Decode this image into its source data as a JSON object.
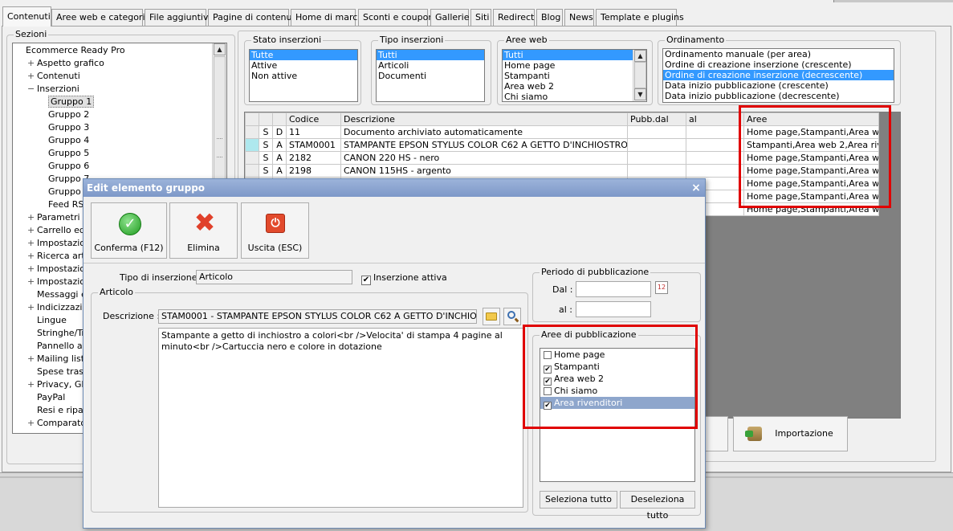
{
  "tabs": [
    "Contenuti",
    "Aree web e categorie",
    "File aggiuntivi",
    "Pagine di contenuti",
    "Home di marca",
    "Sconti e coupon",
    "Gallerie",
    "Siti",
    "Redirect",
    "Blog",
    "News",
    "Template e plugins"
  ],
  "sections": {
    "legend": "Sezioni",
    "tree": [
      {
        "label": "Ecommerce Ready Pro",
        "level": 0,
        "exp": ""
      },
      {
        "label": "Aspetto grafico",
        "level": 1,
        "exp": "+"
      },
      {
        "label": "Contenuti",
        "level": 1,
        "exp": "+"
      },
      {
        "label": "Inserzioni",
        "level": 1,
        "exp": "-"
      },
      {
        "label": "Gruppo 1",
        "level": 2,
        "exp": "",
        "selected": true
      },
      {
        "label": "Gruppo 2",
        "level": 2,
        "exp": ""
      },
      {
        "label": "Gruppo 3",
        "level": 2,
        "exp": ""
      },
      {
        "label": "Gruppo 4",
        "level": 2,
        "exp": ""
      },
      {
        "label": "Gruppo 5",
        "level": 2,
        "exp": ""
      },
      {
        "label": "Gruppo 6",
        "level": 2,
        "exp": ""
      },
      {
        "label": "Gruppo 7",
        "level": 2,
        "exp": ""
      },
      {
        "label": "Gruppo 8",
        "level": 2,
        "exp": ""
      },
      {
        "label": "Feed RSS",
        "level": 2,
        "exp": ""
      },
      {
        "label": "Parametri u",
        "level": 1,
        "exp": "+"
      },
      {
        "label": "Carrello ed",
        "level": 1,
        "exp": "+"
      },
      {
        "label": "Impostazio",
        "level": 1,
        "exp": "+"
      },
      {
        "label": "Ricerca arti",
        "level": 1,
        "exp": "+"
      },
      {
        "label": "Impostazio",
        "level": 1,
        "exp": "+"
      },
      {
        "label": "Impostazio",
        "level": 1,
        "exp": "+"
      },
      {
        "label": "Messaggi e",
        "level": 1,
        "exp": ""
      },
      {
        "label": "Indicizzazio",
        "level": 1,
        "exp": "+"
      },
      {
        "label": "Lingue",
        "level": 1,
        "exp": ""
      },
      {
        "label": "Stringhe/Tr",
        "level": 1,
        "exp": ""
      },
      {
        "label": "Pannello am",
        "level": 1,
        "exp": ""
      },
      {
        "label": "Mailing list e",
        "level": 1,
        "exp": "+"
      },
      {
        "label": "Spese trasp",
        "level": 1,
        "exp": ""
      },
      {
        "label": "Privacy, GD",
        "level": 1,
        "exp": "+"
      },
      {
        "label": "PayPal",
        "level": 1,
        "exp": ""
      },
      {
        "label": "Resi e ripar",
        "level": 1,
        "exp": ""
      },
      {
        "label": "Comparator",
        "level": 1,
        "exp": "+"
      }
    ]
  },
  "filters": {
    "stato": {
      "legend": "Stato inserzioni",
      "items": [
        "Tutte",
        "Attive",
        "Non attive"
      ],
      "selected": 0
    },
    "tipo": {
      "legend": "Tipo inserzioni",
      "items": [
        "Tutti",
        "Articoli",
        "Documenti"
      ],
      "selected": 0
    },
    "aree": {
      "legend": "Aree web",
      "items": [
        "Tutti",
        "Home page",
        "Stampanti",
        "Area web 2",
        "Chi siamo"
      ],
      "selected": 0
    },
    "ordinamento": {
      "legend": "Ordinamento",
      "items": [
        "Ordinamento manuale (per area)",
        "Ordine di creazione inserzione (crescente)",
        "Ordine di creazione inserzione (decrescente)",
        "Data inizio pubblicazione (crescente)",
        "Data inizio pubblicazione (decrescente)"
      ],
      "selected": 2
    }
  },
  "grid": {
    "headers": [
      "",
      "",
      "",
      "Codice",
      "Descrizione",
      "Pubb.dal",
      "al",
      "Aree"
    ],
    "rows": [
      [
        "",
        "S",
        "D",
        "11",
        "Documento archiviato automaticamente",
        "",
        "",
        "Home page,Stampanti,Area w..."
      ],
      [
        "",
        "S",
        "A",
        "STAM0001",
        "STAMPANTE EPSON STYLUS COLOR C62 A GETTO D'INCHIOSTRO",
        "",
        "",
        "Stampanti,Area web 2,Area riv..."
      ],
      [
        "",
        "S",
        "A",
        "2182",
        "CANON 220 HS - nero",
        "",
        "",
        "Home page,Stampanti,Area w..."
      ],
      [
        "",
        "S",
        "A",
        "2198",
        "CANON 115HS - argento",
        "",
        "",
        "Home page,Stampanti,Area w..."
      ],
      [
        "",
        "",
        "",
        "",
        "",
        "",
        "",
        "Home page,Stampanti,Area w..."
      ],
      [
        "",
        "",
        "",
        "",
        "",
        "",
        "",
        "Home page,Stampanti,Area w..."
      ],
      [
        "",
        "",
        "",
        "",
        "",
        "",
        "",
        "Home page,Stampanti,Area w..."
      ]
    ]
  },
  "background_buttons": {
    "importazione": "Importazione"
  },
  "dialog": {
    "title": "Edit elemento gruppo",
    "close": "×",
    "buttons": {
      "conferma": "Conferma (F12)",
      "elimina": "Elimina",
      "uscita": "Uscita (ESC)"
    },
    "tipo_label": "Tipo di inserzione :",
    "tipo_value": "Articolo",
    "attiva_label": "Inserzione attiva",
    "articolo_legend": "Articolo",
    "descrizione_label": "Descrizione :",
    "descrizione_value": "STAM0001 - STAMPANTE EPSON STYLUS COLOR C62 A GETTO D'INCHIOSTRO",
    "memo": "Stampante a getto di inchiostro a colori<br />Velocita' di stampa 4 pagine al minuto<br />Cartuccia nero e colore in dotazione",
    "periodo_legend": "Periodo di pubblicazione",
    "dal_label": "Dal :",
    "al_label": "al :",
    "aree_legend": "Aree di pubblicazione",
    "aree": [
      {
        "label": "Home page",
        "checked": false
      },
      {
        "label": "Stampanti",
        "checked": true
      },
      {
        "label": "Area web 2",
        "checked": true
      },
      {
        "label": "Chi siamo",
        "checked": false
      },
      {
        "label": "Area rivenditori",
        "checked": true,
        "selected": true
      }
    ],
    "seleziona": "Seleziona tutto",
    "deseleziona": "Deseleziona tutto"
  },
  "colors": {
    "selection": "#3399ff",
    "highlight_box": "#e00000",
    "grid_background": "#808080",
    "dialog_title": "#7d98c8"
  }
}
